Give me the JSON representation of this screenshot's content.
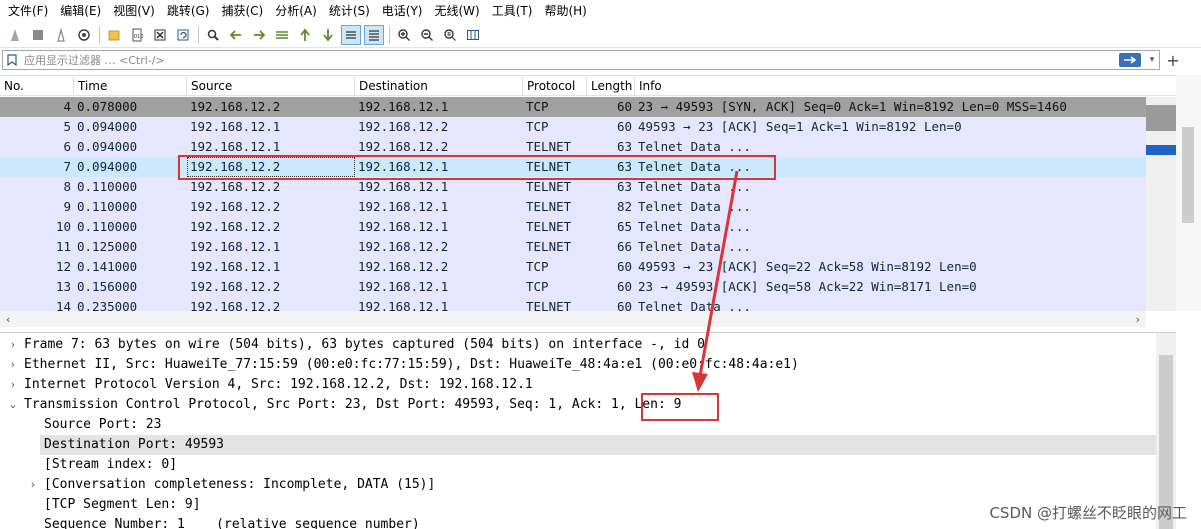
{
  "menu": [
    "文件(F)",
    "编辑(E)",
    "视图(V)",
    "跳转(G)",
    "捕获(C)",
    "分析(A)",
    "统计(S)",
    "电话(Y)",
    "无线(W)",
    "工具(T)",
    "帮助(H)"
  ],
  "toolbar": {
    "icons": [
      "shark-fin-start-icon",
      "stop-square-icon",
      "restart-fin-icon",
      "capture-options-icon",
      "open-file-icon",
      "file-icon",
      "close-file-icon",
      "reload-icon",
      "find-icon",
      "back-arrow-icon",
      "forward-arrow-icon",
      "go-to-packet-icon",
      "first-packet-icon",
      "last-packet-icon",
      "autoscroll-icon",
      "colorize-icon",
      "zoom-in-icon",
      "zoom-out-icon",
      "normal-size-icon",
      "resize-columns-icon"
    ]
  },
  "filter": {
    "placeholder": "应用显示过滤器 … <Ctrl-/>"
  },
  "packet_list": {
    "columns": [
      "No.",
      "Time",
      "Source",
      "Destination",
      "Protocol",
      "Length",
      "Info"
    ],
    "rows": [
      {
        "no": "4",
        "time": "0.078000",
        "src": "192.168.12.2",
        "dst": "192.168.12.1",
        "proto": "TCP",
        "len": "60",
        "info": "23 → 49593 [SYN, ACK] Seq=0 Ack=1 Win=8192 Len=0 MSS=1460"
      },
      {
        "no": "5",
        "time": "0.094000",
        "src": "192.168.12.1",
        "dst": "192.168.12.2",
        "proto": "TCP",
        "len": "60",
        "info": "49593 → 23 [ACK] Seq=1 Ack=1 Win=8192 Len=0"
      },
      {
        "no": "6",
        "time": "0.094000",
        "src": "192.168.12.1",
        "dst": "192.168.12.2",
        "proto": "TELNET",
        "len": "63",
        "info": "Telnet Data ..."
      },
      {
        "no": "7",
        "time": "0.094000",
        "src": "192.168.12.2",
        "dst": "192.168.12.1",
        "proto": "TELNET",
        "len": "63",
        "info": "Telnet Data ..."
      },
      {
        "no": "8",
        "time": "0.110000",
        "src": "192.168.12.2",
        "dst": "192.168.12.1",
        "proto": "TELNET",
        "len": "63",
        "info": "Telnet Data ..."
      },
      {
        "no": "9",
        "time": "0.110000",
        "src": "192.168.12.2",
        "dst": "192.168.12.1",
        "proto": "TELNET",
        "len": "82",
        "info": "Telnet Data ..."
      },
      {
        "no": "10",
        "time": "0.110000",
        "src": "192.168.12.2",
        "dst": "192.168.12.1",
        "proto": "TELNET",
        "len": "65",
        "info": "Telnet Data ..."
      },
      {
        "no": "11",
        "time": "0.125000",
        "src": "192.168.12.1",
        "dst": "192.168.12.2",
        "proto": "TELNET",
        "len": "66",
        "info": "Telnet Data ..."
      },
      {
        "no": "12",
        "time": "0.141000",
        "src": "192.168.12.1",
        "dst": "192.168.12.2",
        "proto": "TCP",
        "len": "60",
        "info": "49593 → 23 [ACK] Seq=22 Ack=58 Win=8192 Len=0"
      },
      {
        "no": "13",
        "time": "0.156000",
        "src": "192.168.12.2",
        "dst": "192.168.12.1",
        "proto": "TCP",
        "len": "60",
        "info": "23 → 49593 [ACK] Seq=58 Ack=22 Win=8171 Len=0"
      },
      {
        "no": "14",
        "time": "0.235000",
        "src": "192.168.12.2",
        "dst": "192.168.12.1",
        "proto": "TELNET",
        "len": "60",
        "info": "Telnet Data ..."
      }
    ]
  },
  "details": {
    "rows": [
      {
        "expand": "collapsed",
        "text": "Frame 7: 63 bytes on wire (504 bits), 63 bytes captured (504 bits) on interface -, id 0"
      },
      {
        "expand": "collapsed",
        "text": "Ethernet II, Src: HuaweiTe_77:15:59 (00:e0:fc:77:15:59), Dst: HuaweiTe_48:4a:e1 (00:e0:fc:48:4a:e1)"
      },
      {
        "expand": "collapsed",
        "text": "Internet Protocol Version 4, Src: 192.168.12.2, Dst: 192.168.12.1"
      },
      {
        "expand": "expanded",
        "text": "Transmission Control Protocol, Src Port: 23, Dst Port: 49593, Seq: 1, Ack: 1, Len: 9"
      },
      {
        "expand": "none",
        "text": "Source Port: 23"
      },
      {
        "expand": "none",
        "text": "Destination Port: 49593"
      },
      {
        "expand": "none",
        "text": "[Stream index: 0]"
      },
      {
        "expand": "collapsed",
        "text": "[Conversation completeness: Incomplete, DATA (15)]"
      },
      {
        "expand": "none",
        "text": "[TCP Segment Len: 9]"
      },
      {
        "expand": "none",
        "text": "Sequence Number: 1    (relative sequence number)"
      }
    ]
  },
  "watermark": "CSDN @打螺丝不眨眼的网工",
  "colors": {
    "row_bg": "#e7e6ff",
    "row_gray": "#a0a0a0",
    "row_selected": "#cce8ff",
    "annotation": "#d9343a",
    "filter_apply": "#3a70b8"
  }
}
